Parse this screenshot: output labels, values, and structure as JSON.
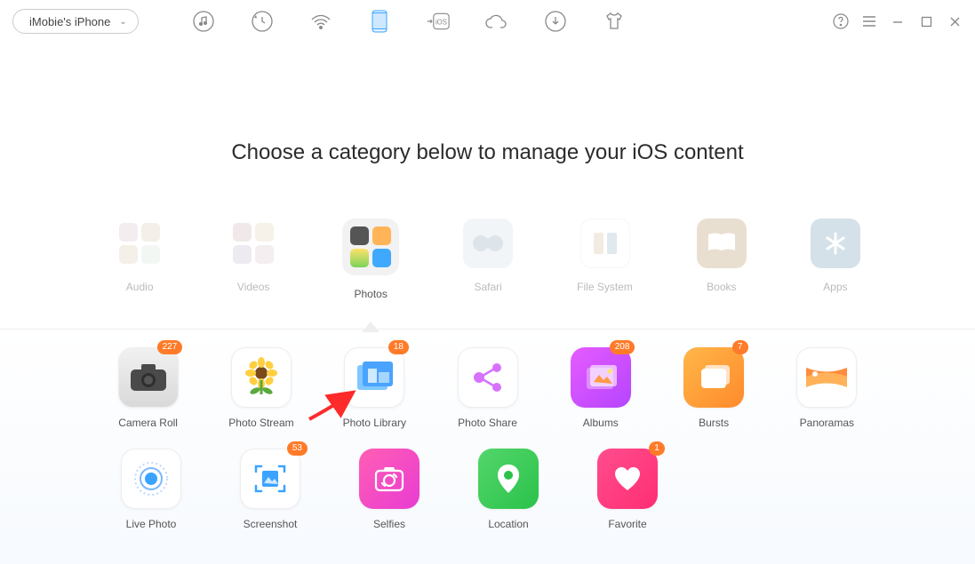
{
  "device": {
    "name": "iMobie's iPhone"
  },
  "heading": "Choose a category below to manage your iOS content",
  "toolbar_icons": [
    {
      "name": "music-icon"
    },
    {
      "name": "history-icon"
    },
    {
      "name": "wifi-icon"
    },
    {
      "name": "phone-icon",
      "active": true
    },
    {
      "name": "to-ios-icon"
    },
    {
      "name": "cloud-icon"
    },
    {
      "name": "download-icon"
    },
    {
      "name": "tshirt-icon"
    }
  ],
  "categories": [
    {
      "key": "audio",
      "label": "Audio",
      "faded": true
    },
    {
      "key": "videos",
      "label": "Videos",
      "faded": true
    },
    {
      "key": "photos",
      "label": "Photos",
      "faded": false,
      "selected": true
    },
    {
      "key": "safari",
      "label": "Safari",
      "faded": true
    },
    {
      "key": "filesystem",
      "label": "File System",
      "faded": true
    },
    {
      "key": "books",
      "label": "Books",
      "faded": true
    },
    {
      "key": "apps",
      "label": "Apps",
      "faded": true
    }
  ],
  "sub": {
    "row1": [
      {
        "key": "cameraroll",
        "label": "Camera Roll",
        "badge": "227"
      },
      {
        "key": "photostream",
        "label": "Photo Stream"
      },
      {
        "key": "photolib",
        "label": "Photo Library",
        "badge": "18"
      },
      {
        "key": "photoshare",
        "label": "Photo Share"
      },
      {
        "key": "albums",
        "label": "Albums",
        "badge": "208"
      },
      {
        "key": "bursts",
        "label": "Bursts",
        "badge": "7"
      },
      {
        "key": "panoramas",
        "label": "Panoramas"
      }
    ],
    "row2": [
      {
        "key": "livephoto",
        "label": "Live Photo"
      },
      {
        "key": "screenshot",
        "label": "Screenshot",
        "badge": "53"
      },
      {
        "key": "selfies",
        "label": "Selfies"
      },
      {
        "key": "location",
        "label": "Location"
      },
      {
        "key": "favorite",
        "label": "Favorite",
        "badge": "1"
      }
    ]
  }
}
